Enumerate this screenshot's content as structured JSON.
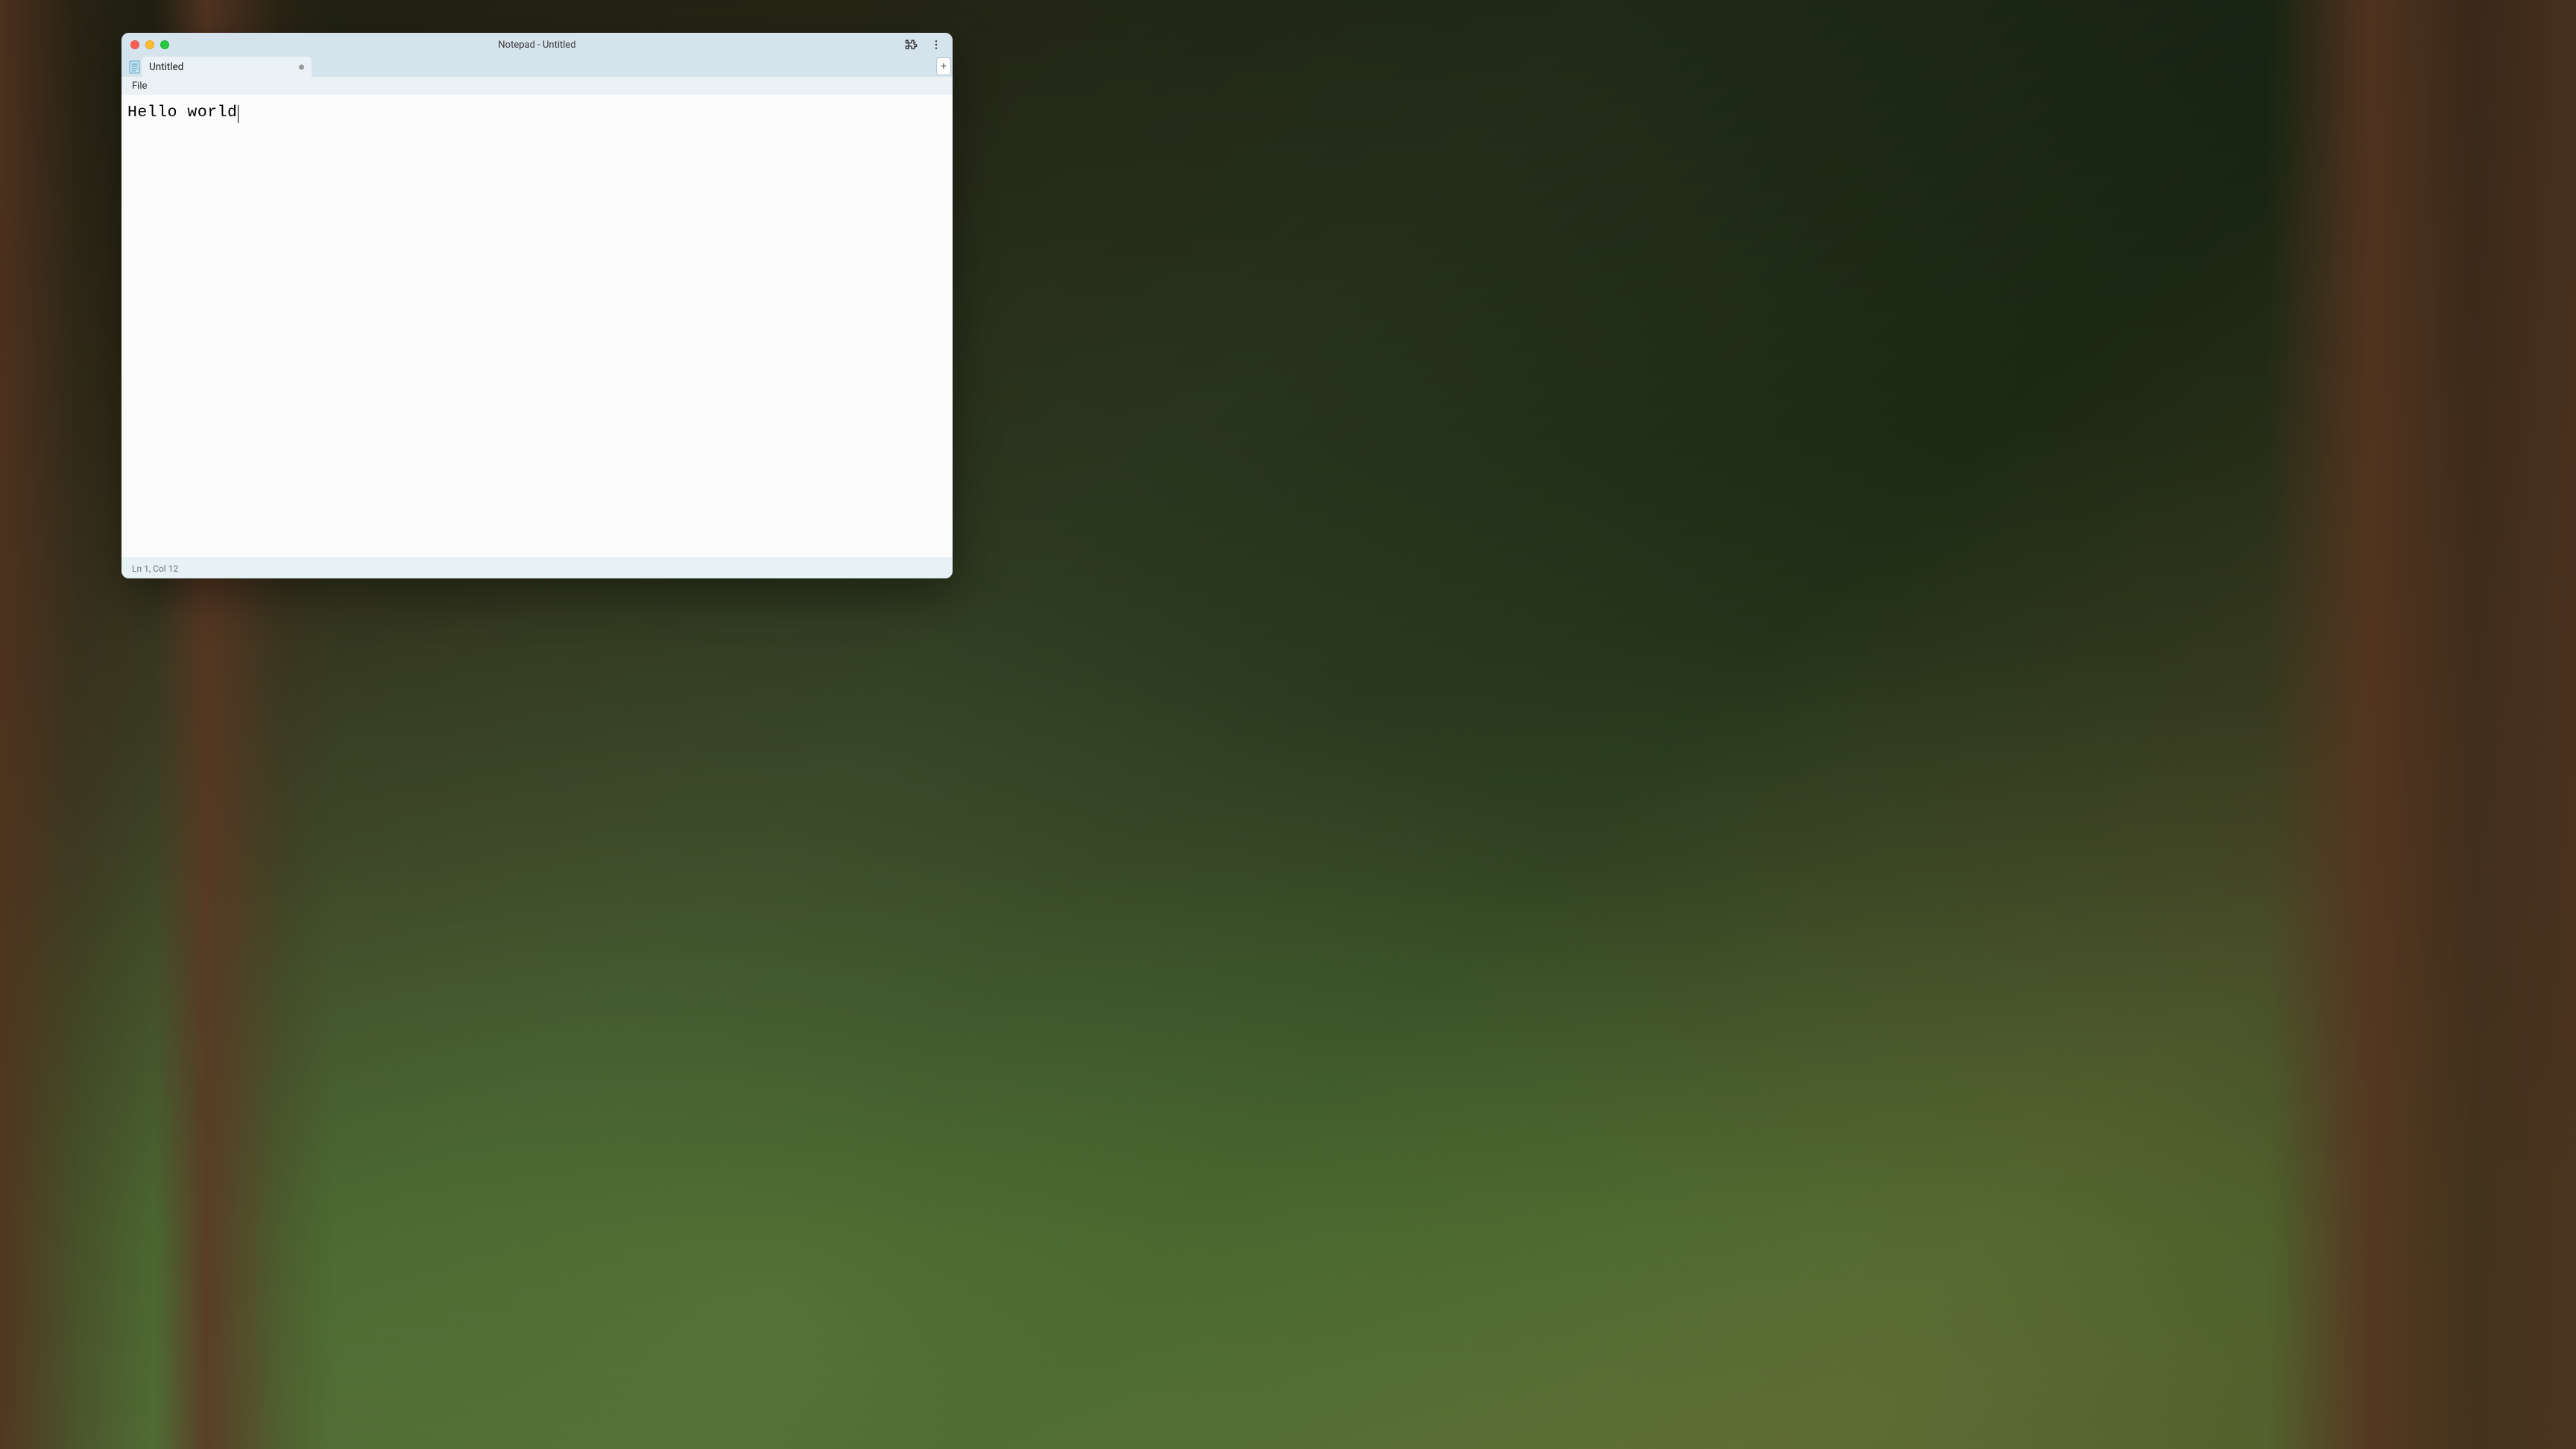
{
  "window": {
    "title": "Notepad - Untitled"
  },
  "tabs": [
    {
      "label": "Untitled"
    }
  ],
  "new_tab_label": "+",
  "menubar": {
    "file": "File"
  },
  "editor": {
    "content": "Hello world"
  },
  "statusbar": {
    "position": "Ln 1, Col 12"
  }
}
